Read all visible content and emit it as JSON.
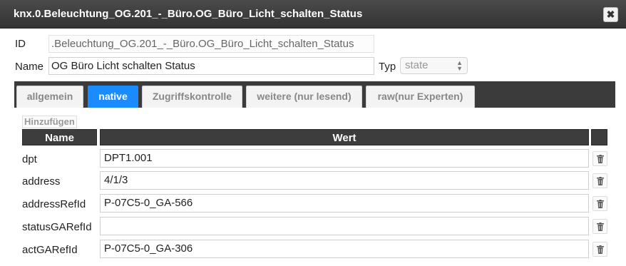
{
  "dialog": {
    "title": "knx.0.Beleuchtung_OG.201_-_Büro.OG_Büro_Licht_schalten_Status",
    "close_label": "✖"
  },
  "form": {
    "id_label": "ID",
    "id_value": ".Beleuchtung_OG.201_-_Büro.OG_Büro_Licht_schalten_Status",
    "name_label": "Name",
    "name_value": "OG Büro Licht schalten Status",
    "type_label": "Typ",
    "type_value": "state"
  },
  "tabs": [
    {
      "label": "allgemein"
    },
    {
      "label": "native"
    },
    {
      "label": "Zugriffskontrolle"
    },
    {
      "label": "weitere (nur lesend)"
    },
    {
      "label": "raw(nur Experten)"
    }
  ],
  "table": {
    "add_label": "Hinzufügen",
    "headers": {
      "name": "Name",
      "value": "Wert"
    },
    "rows": [
      {
        "name": "dpt",
        "value": "DPT1.001"
      },
      {
        "name": "address",
        "value": "4/1/3"
      },
      {
        "name": "addressRefId",
        "value": "P-07C5-0_GA-566"
      },
      {
        "name": "statusGARefId",
        "value": ""
      },
      {
        "name": "actGARefId",
        "value": "P-07C5-0_GA-306"
      }
    ]
  },
  "colors": {
    "titlebar": "#3b3b3b",
    "active_tab": "#1a8cff"
  }
}
